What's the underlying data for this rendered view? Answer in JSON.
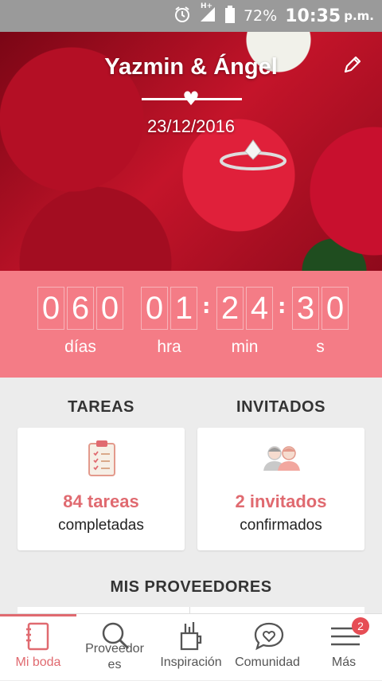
{
  "status_bar": {
    "network": "H+",
    "battery": "72%",
    "time": "10:35",
    "ampm": "p.m.",
    "icons": [
      "alarm-icon",
      "signal-icon",
      "battery-icon"
    ]
  },
  "hero": {
    "couple": "Yazmin & Ángel",
    "date": "23/12/2016",
    "icons": [
      "edit-icon",
      "heart-icon"
    ]
  },
  "countdown": {
    "days": [
      "0",
      "6",
      "0"
    ],
    "hours": [
      "0",
      "1"
    ],
    "minutes": [
      "2",
      "4"
    ],
    "seconds": [
      "3",
      "0"
    ],
    "labels": {
      "days": "días",
      "hours": "hra",
      "minutes": "min",
      "seconds": "s"
    }
  },
  "sections": {
    "tasks_title": "TAREAS",
    "guests_title": "INVITADOS",
    "vendors_title": "MIS PROVEEDORES"
  },
  "cards": {
    "tasks": {
      "count": "84 tareas",
      "sub": "completadas",
      "icon": "clipboard-icon"
    },
    "guests": {
      "count": "2 invitados",
      "sub": "confirmados",
      "icon": "people-icon"
    }
  },
  "nav": {
    "items": [
      {
        "label": "Mi boda",
        "icon": "notebook-icon",
        "active": true
      },
      {
        "label": "Proveedores",
        "icon": "search-icon"
      },
      {
        "label": "Inspiración",
        "icon": "pencil-cup-icon"
      },
      {
        "label": "Comunidad",
        "icon": "chat-heart-icon"
      },
      {
        "label": "Más",
        "icon": "menu-icon",
        "badge": "2"
      }
    ]
  },
  "colors": {
    "accent": "#e06a70",
    "countdown_bg": "#f47c86",
    "badge": "#e64d55"
  }
}
